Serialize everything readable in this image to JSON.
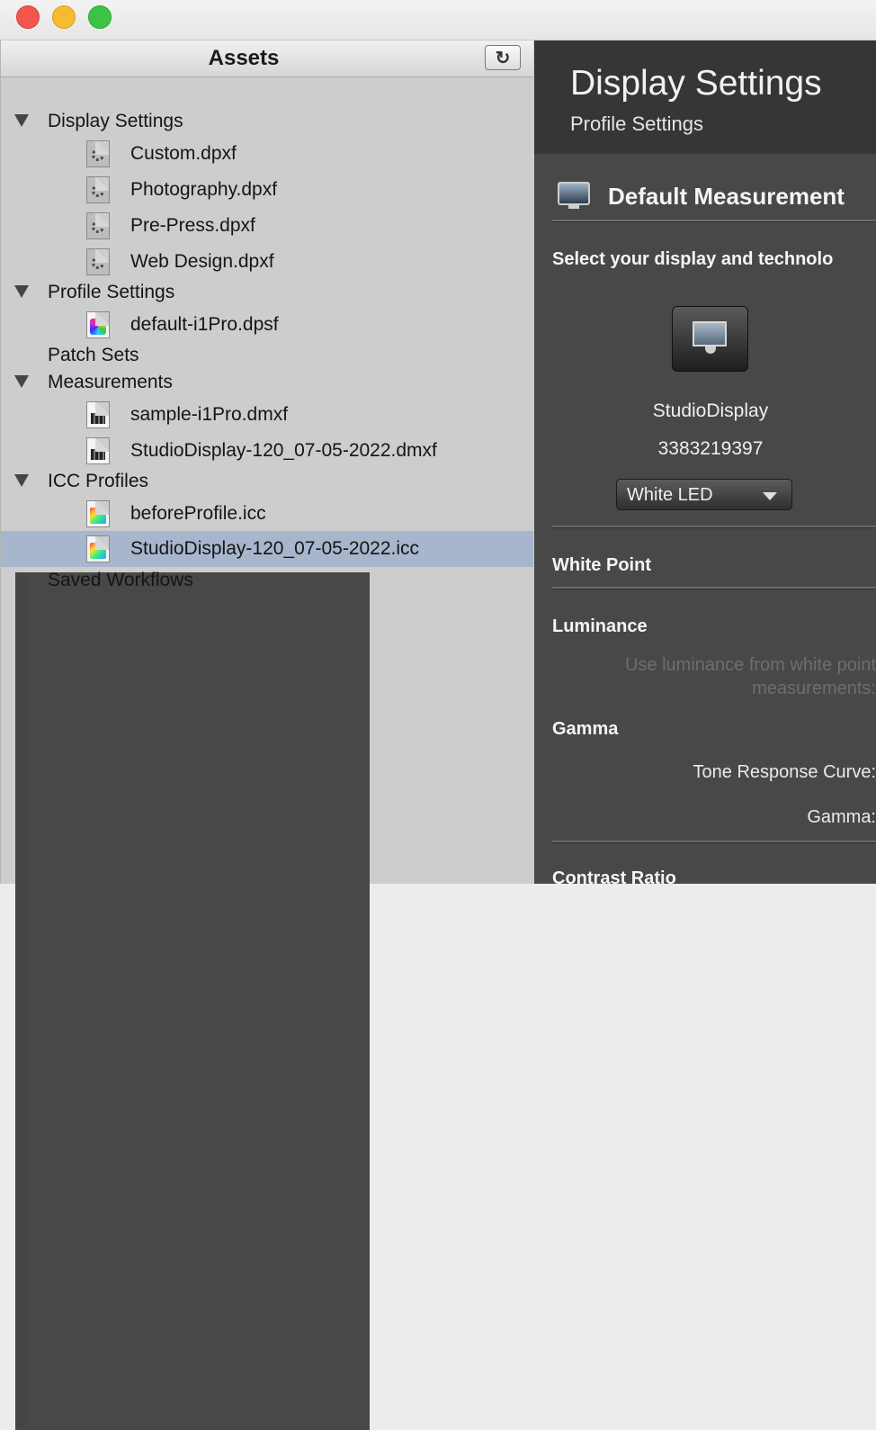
{
  "window": {
    "controls": [
      "close-light",
      "minimize-light",
      "zoom-light"
    ]
  },
  "assets_panel": {
    "title": "Assets",
    "refresh_icon_glyph": "↻",
    "tree": {
      "display_settings": {
        "label": "Display Settings",
        "files": [
          "Custom.dpxf",
          "Photography.dpxf",
          "Pre-Press.dpxf",
          "Web Design.dpxf"
        ]
      },
      "profile_settings": {
        "label": "Profile Settings",
        "files": [
          "default-i1Pro.dpsf"
        ]
      },
      "patch_sets": {
        "label": "Patch Sets"
      },
      "measurements": {
        "label": "Measurements",
        "files": [
          "sample-i1Pro.dmxf",
          "StudioDisplay-120_07-05-2022.dmxf"
        ]
      },
      "icc_profiles": {
        "label": "ICC Profiles",
        "files": [
          "beforeProfile.icc",
          "StudioDisplay-120_07-05-2022.icc"
        ]
      },
      "saved_workflows": {
        "label": "Saved Workflows"
      }
    },
    "selected_color": "#a7b6cd"
  },
  "settings_panel": {
    "title": "Display Settings",
    "subtitle": "Profile Settings",
    "measurement_title": "Default Measurement",
    "select_prompt": "Select your display and technolo",
    "display_name": "StudioDisplay",
    "display_id": "3383219397",
    "technology_select": {
      "value": "White LED"
    },
    "white_point": "White Point",
    "luminance": "Luminance",
    "luminance_hint_line1": "Use luminance from white point",
    "luminance_hint_line2": "measurements:",
    "gamma": "Gamma",
    "tone_response_curve": "Tone Response Curve:",
    "gamma_label": "Gamma:",
    "contrast_ratio": "Contrast Ratio"
  }
}
